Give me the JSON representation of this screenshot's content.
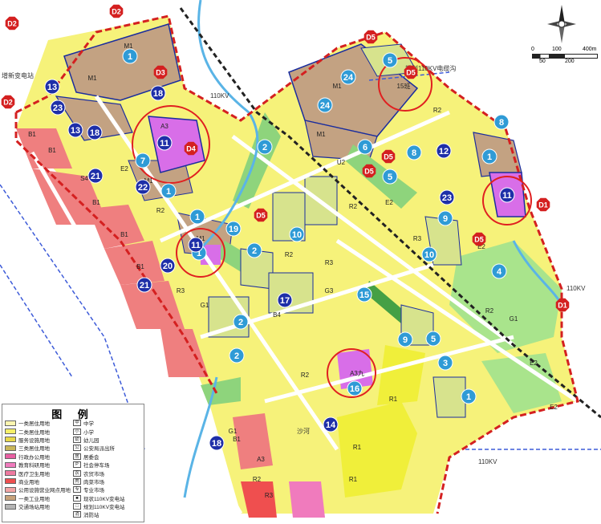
{
  "legend": {
    "title": "图 例",
    "landuse": [
      {
        "label": "一类居住用地",
        "color": "#fbf5b0"
      },
      {
        "label": "二类居住用地",
        "color": "#f6f069"
      },
      {
        "label": "服务设施用地",
        "color": "#e8d84a"
      },
      {
        "label": "三类居住用地",
        "color": "#c9b65a"
      },
      {
        "label": "行政办公用地",
        "color": "#e85fa2"
      },
      {
        "label": "教育科研用地",
        "color": "#f07bbd"
      },
      {
        "label": "医疗卫生用地",
        "color": "#ee7aa0"
      },
      {
        "label": "商业用地",
        "color": "#ef4f4f"
      },
      {
        "label": "公用设施营业网点用地",
        "color": "#f2a5a5"
      },
      {
        "label": "一类工业用地",
        "color": "#c7a27a"
      },
      {
        "label": "交通场站用地",
        "color": "#b4b4b4"
      }
    ],
    "symbols": [
      {
        "label": "中学",
        "glyph": "中"
      },
      {
        "label": "小学",
        "glyph": "小"
      },
      {
        "label": "幼儿园",
        "glyph": "幼"
      },
      {
        "label": "公安局派出所",
        "glyph": "公"
      },
      {
        "label": "居委会",
        "glyph": "居"
      },
      {
        "label": "社会停车场",
        "glyph": "P"
      },
      {
        "label": "农贸市场",
        "glyph": "农"
      },
      {
        "label": "肉菜市场",
        "glyph": "肉"
      },
      {
        "label": "专业市场",
        "glyph": "专"
      },
      {
        "label": "现状110KV变电站",
        "glyph": "■"
      },
      {
        "label": "规划110KV变电站",
        "glyph": "□"
      },
      {
        "label": "消防站",
        "glyph": "消"
      }
    ]
  },
  "scale": {
    "labels": [
      "0",
      "100",
      "400m",
      "50",
      "200"
    ]
  },
  "map_labels": {
    "road_a": "规划110KV电缆沟",
    "road_b": "110KV",
    "road_c": "110KV",
    "road_d": "110KV",
    "substation": "增新变电站",
    "river": "沙河"
  },
  "zones": [
    {
      "label": "M1"
    },
    {
      "label": "R2"
    },
    {
      "label": "R3"
    },
    {
      "label": "B1"
    },
    {
      "label": "E2"
    },
    {
      "label": "G1"
    },
    {
      "label": "R1"
    },
    {
      "label": "A3"
    },
    {
      "label": "S4"
    },
    {
      "label": "U2"
    },
    {
      "label": "B4"
    },
    {
      "label": "G3"
    },
    {
      "label": "A3九"
    },
    {
      "label": "15班"
    }
  ],
  "markers": [
    "1",
    "2",
    "3",
    "4",
    "5",
    "6",
    "7",
    "8",
    "9",
    "10",
    "11",
    "12",
    "13",
    "14",
    "15",
    "16",
    "17",
    "18",
    "19",
    "20",
    "21",
    "22",
    "23",
    "24"
  ],
  "dtags": [
    "D1",
    "D2",
    "D3",
    "D4",
    "D5"
  ]
}
